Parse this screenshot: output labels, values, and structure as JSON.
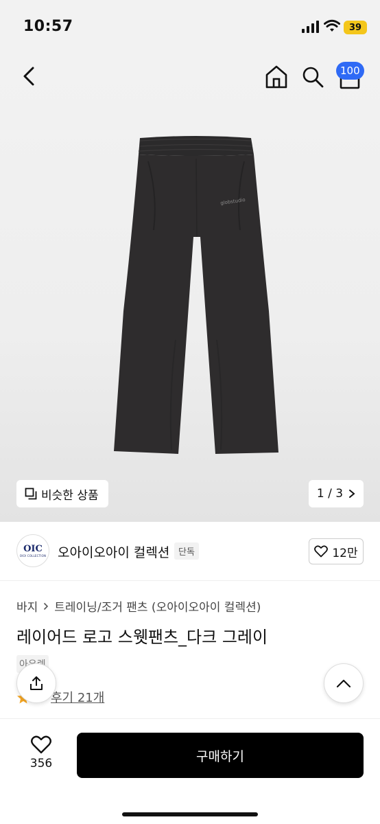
{
  "status_bar": {
    "time": "10:57",
    "battery": "39"
  },
  "header": {
    "cart_count": "100"
  },
  "gallery": {
    "similar_label": "비슷한 상품",
    "pager": "1 / 3",
    "product_logo_text": "globstudio"
  },
  "brand": {
    "name": "오아이오아이 컬렉션",
    "tag": "단독",
    "logo_mark": "OIC",
    "logo_sub": "OIOI COLLECTION",
    "likes": "12만"
  },
  "product": {
    "breadcrumb": [
      "바지",
      "트레이닝/조거 팬츠 (오아이오아이 컬렉션)"
    ],
    "title": "레이어드 로고 스웻팬츠_다크 그레이",
    "tag": "아우렛",
    "review_label": "후기 21개"
  },
  "bottom": {
    "wish_count": "356",
    "buy_label": "구매하기"
  },
  "colors": {
    "accent": "#2f6af5",
    "battery": "#f4c61b",
    "star": "#f5a623",
    "pants": "#2e2c2d"
  }
}
